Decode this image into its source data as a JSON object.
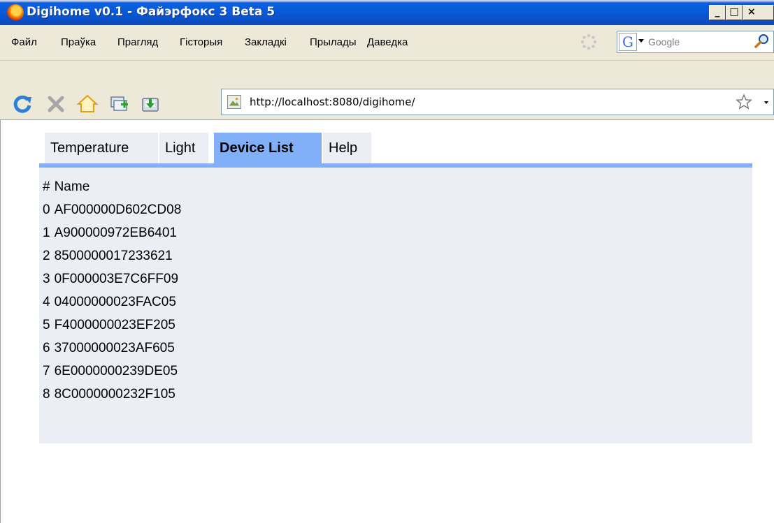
{
  "window": {
    "title": "Digihome v0.1 - Файэрфокс 3 Beta 5",
    "buttons": {
      "minimize": "_",
      "maximize": "□",
      "close": "×"
    }
  },
  "menubar": {
    "items": [
      "Файл",
      "Праўка",
      "Прагляд",
      "Гісторыя",
      "Закладкі",
      "Прылады",
      "Даведка"
    ]
  },
  "search": {
    "placeholder": "Google",
    "engine_letter": "G"
  },
  "navbar": {
    "url": "http://localhost:8080/digihome/",
    "icons": [
      "reload-icon",
      "stop-icon",
      "home-icon",
      "new-tab-icon",
      "download-icon"
    ]
  },
  "tabs": [
    {
      "label": "Temperature",
      "active": false
    },
    {
      "label": "Light",
      "active": false
    },
    {
      "label": "Device List",
      "active": true
    },
    {
      "label": "Help",
      "active": false
    }
  ],
  "device_table": {
    "header": {
      "num": "#",
      "name": "Name"
    },
    "rows": [
      {
        "num": "0",
        "name": "AF000000D602CD08"
      },
      {
        "num": "1",
        "name": "A900000972EB6401"
      },
      {
        "num": "2",
        "name": "8500000017233621"
      },
      {
        "num": "3",
        "name": "0F000003E7C6FF09"
      },
      {
        "num": "4",
        "name": "04000000023FAC05"
      },
      {
        "num": "5",
        "name": "F4000000023EF205"
      },
      {
        "num": "6",
        "name": "37000000023AF605"
      },
      {
        "num": "7",
        "name": "6E0000000239DE05"
      },
      {
        "num": "8",
        "name": "8C0000000232F105"
      }
    ]
  },
  "colors": {
    "tab_active": "#82b0f8",
    "panel_bg": "#eceef5",
    "titlebar": "#0a56d5"
  }
}
